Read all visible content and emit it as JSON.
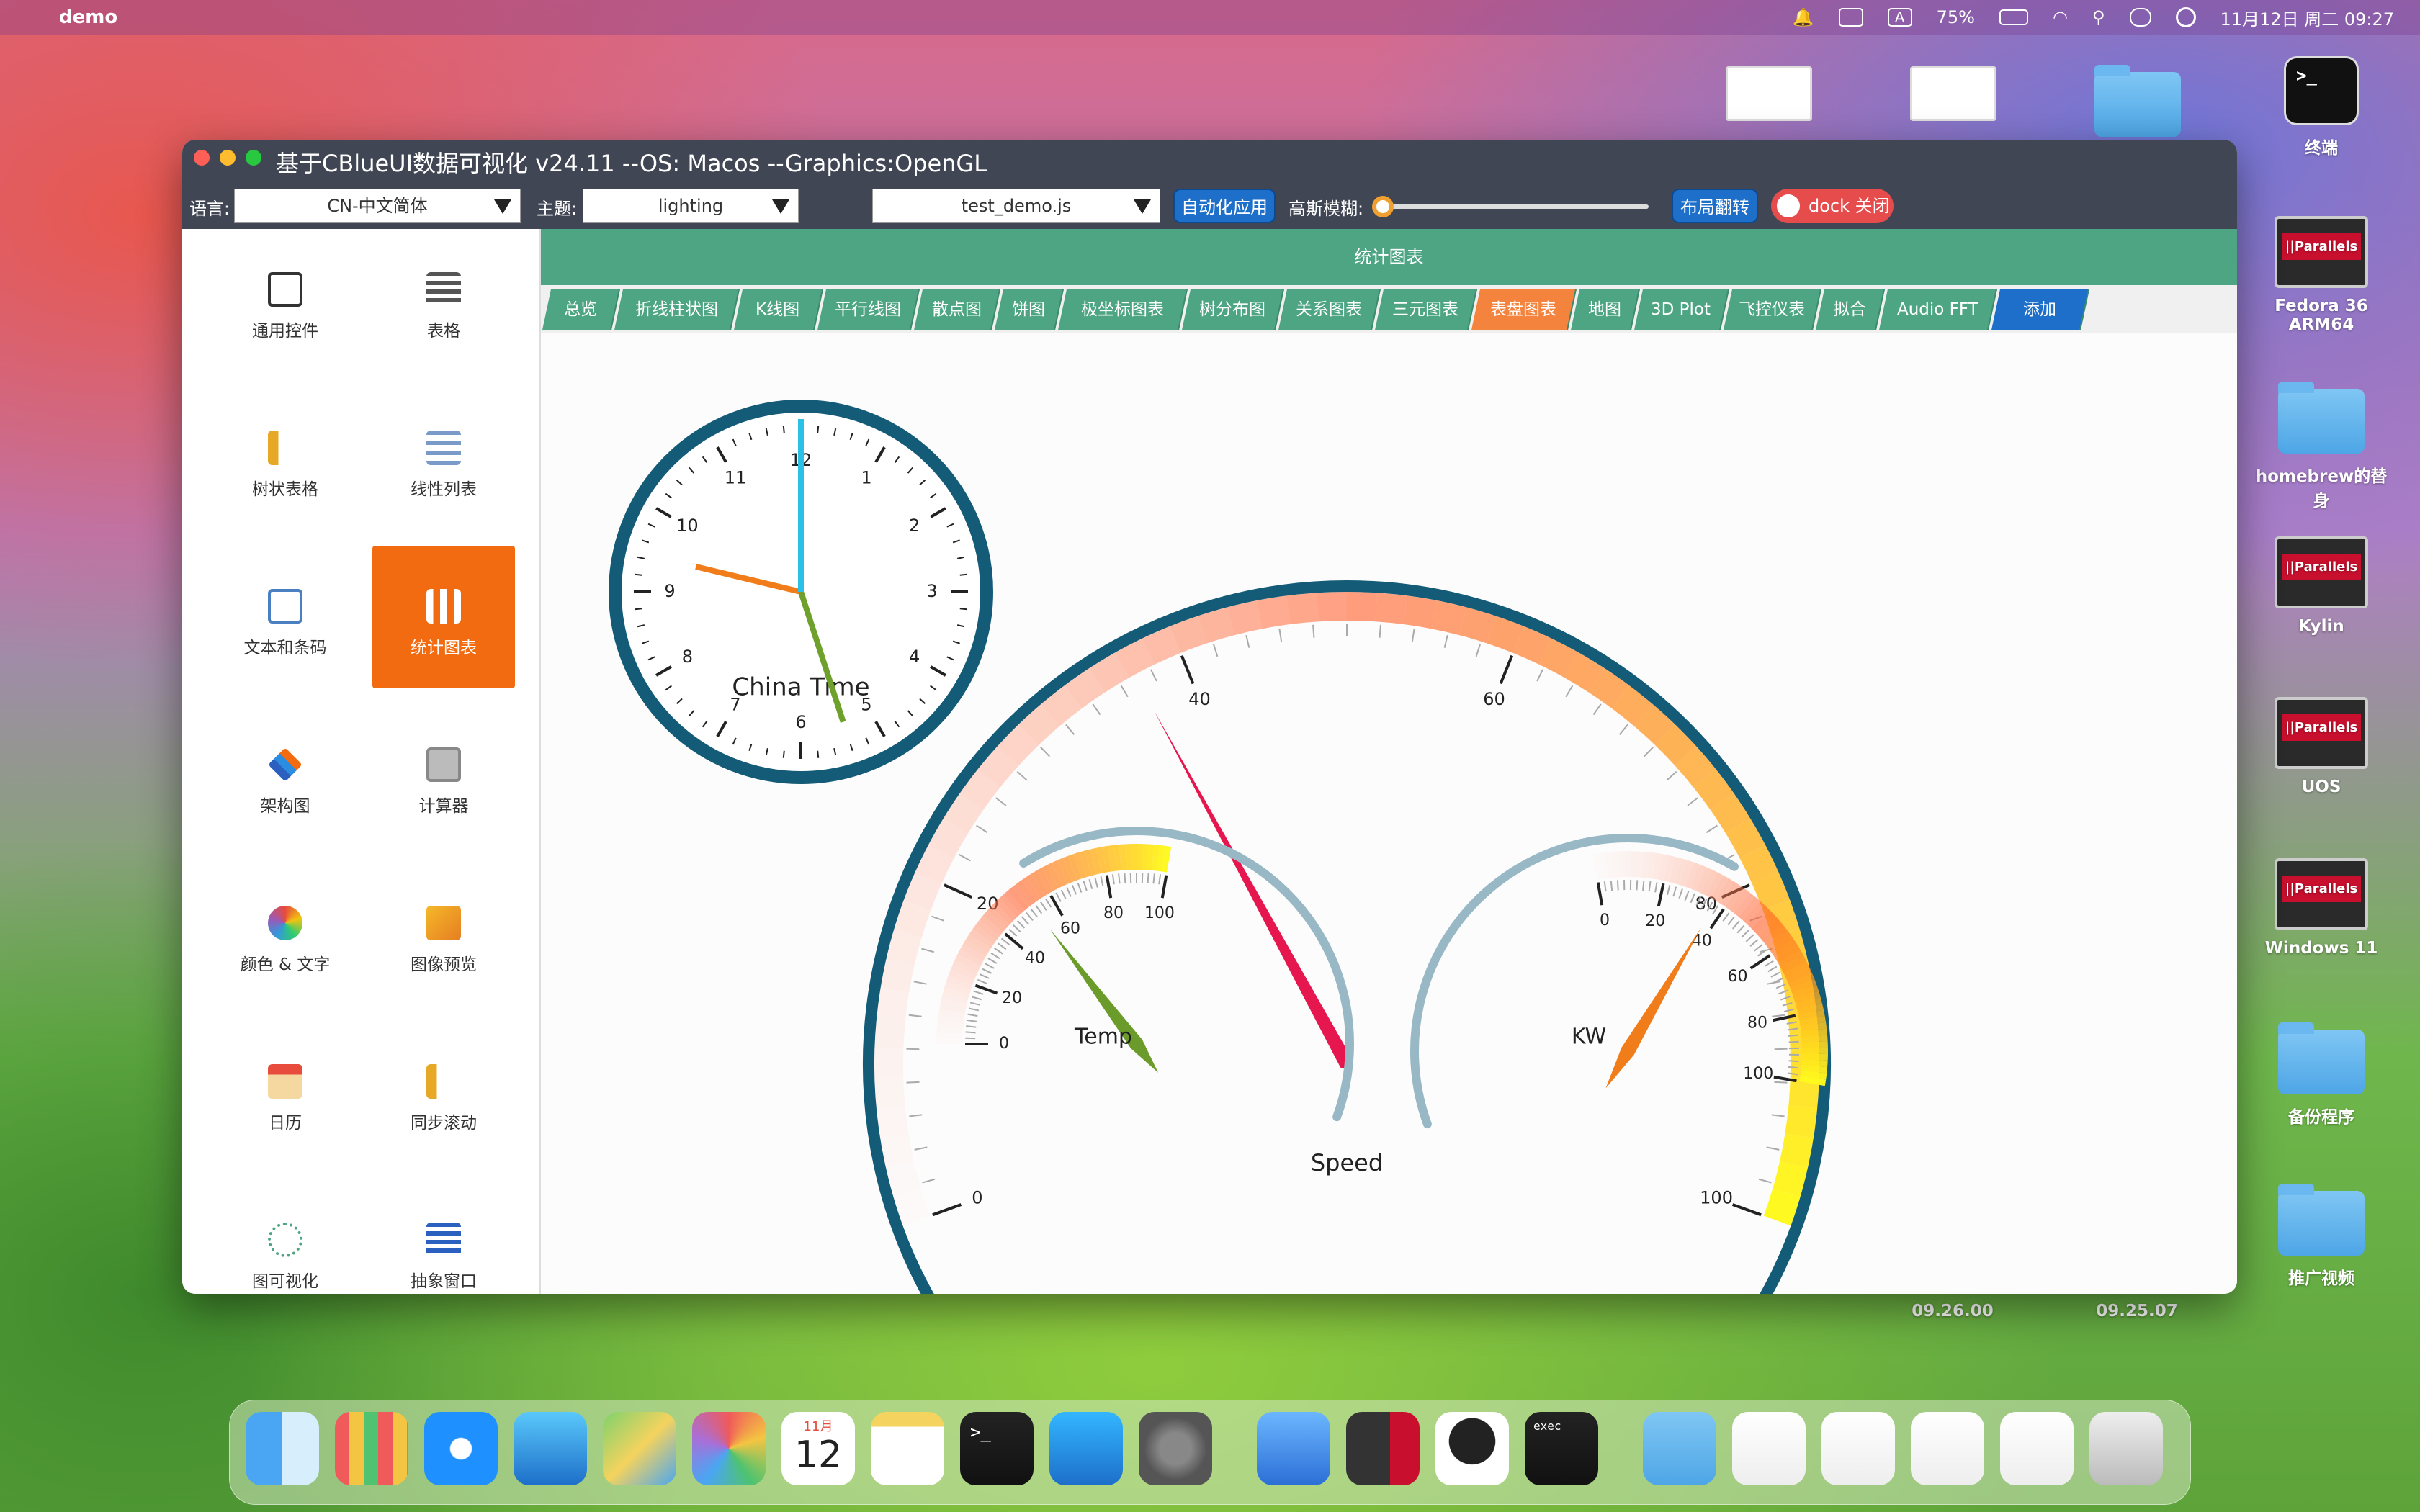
{
  "menubar": {
    "app_name": "demo",
    "input_indicator": "A",
    "battery": "75%",
    "datetime": "11月12日 周二 09:27"
  },
  "desktop": {
    "items": [
      {
        "label": "终端"
      },
      {
        "label": "Fedora 36 ARM64",
        "badge": "||Parallels"
      },
      {
        "label": "homebrew的替身"
      },
      {
        "label": "Kylin",
        "badge": "||Parallels"
      },
      {
        "label": "UOS",
        "badge": "||Parallels"
      },
      {
        "label": "Windows 11",
        "badge": "||Parallels"
      },
      {
        "label": "备份程序"
      },
      {
        "label": "推广视频"
      }
    ],
    "thumb_labels": [
      "09.26.00",
      "09.25.07"
    ]
  },
  "window": {
    "title": "基于CBlueUI数据可视化  v24.11  --OS: Macos  --Graphics:OpenGL",
    "toolbar": {
      "lang_label": "语言:",
      "lang_value": "CN-中文简体",
      "theme_label": "主题:",
      "theme_value": "lighting",
      "script_value": "test_demo.js",
      "auto_button": "自动化应用",
      "blur_label": "高斯模糊:",
      "layout_button": "布局翻转",
      "dock_button": "dock 关闭"
    },
    "colors": {
      "titlebar": "#414654",
      "accent_green": "#4ea583",
      "accent_orange": "#f26b10",
      "button_blue": "#1d6fc9"
    }
  },
  "sidebar": {
    "items": [
      {
        "label": "通用控件",
        "icon": "code-window-icon"
      },
      {
        "label": "表格",
        "icon": "table-icon"
      },
      {
        "label": "树状表格",
        "icon": "tree-table-icon"
      },
      {
        "label": "线性列表",
        "icon": "list-icon"
      },
      {
        "label": "文本和条码",
        "icon": "text-icon"
      },
      {
        "label": "统计图表",
        "icon": "chart-icon",
        "active": true
      },
      {
        "label": "架构图",
        "icon": "layers-icon"
      },
      {
        "label": "计算器",
        "icon": "calculator-icon"
      },
      {
        "label": "颜色 & 文字",
        "icon": "color-wheel-icon"
      },
      {
        "label": "图像预览",
        "icon": "image-icon"
      },
      {
        "label": "日历",
        "icon": "calendar-icon"
      },
      {
        "label": "同步滚动",
        "icon": "sync-scroll-icon"
      },
      {
        "label": "图可视化",
        "icon": "graph-icon"
      },
      {
        "label": "抽象窗口",
        "icon": "window-icon"
      }
    ]
  },
  "main": {
    "section_title": "统计图表",
    "tabs": [
      "总览",
      "折线柱状图",
      "K线图",
      "平行线图",
      "散点图",
      "饼图",
      "极坐标图表",
      "树分布图",
      "关系图表",
      "三元图表",
      "表盘图表",
      "地图",
      "3D Plot",
      "飞控仪表",
      "拟合",
      "Audio FFT",
      "添加"
    ],
    "active_tab": "表盘图表"
  },
  "chart_data": [
    {
      "type": "clock",
      "title": "China Time",
      "hours": [
        12,
        1,
        2,
        3,
        4,
        5,
        6,
        7,
        8,
        9,
        10,
        11
      ],
      "time": "09:27"
    },
    {
      "type": "gauge",
      "title": "Speed",
      "min": 0,
      "max": 100,
      "ticks": [
        0,
        20,
        40,
        60,
        80,
        100
      ],
      "value": 37
    },
    {
      "type": "gauge",
      "title": "Temp",
      "min": 0,
      "max": 100,
      "ticks": [
        0,
        20,
        40,
        60,
        80,
        100
      ],
      "value": 53
    },
    {
      "type": "gauge",
      "title": "KW",
      "min": 0,
      "max": 100,
      "ticks": [
        0,
        20,
        40,
        60,
        80,
        100
      ],
      "value": 37
    }
  ],
  "dock": {
    "calendar_month": "11月",
    "calendar_day": "12",
    "exec_label": "exec"
  }
}
